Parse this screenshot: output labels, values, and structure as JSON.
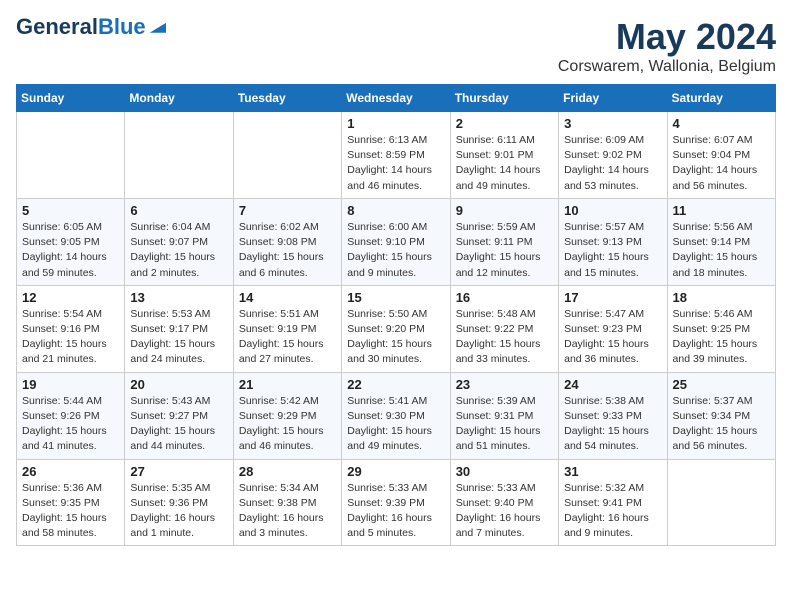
{
  "header": {
    "logo_general": "General",
    "logo_blue": "Blue",
    "title": "May 2024",
    "subtitle": "Corswarem, Wallonia, Belgium"
  },
  "days_of_week": [
    "Sunday",
    "Monday",
    "Tuesday",
    "Wednesday",
    "Thursday",
    "Friday",
    "Saturday"
  ],
  "weeks": [
    [
      {
        "num": "",
        "info": ""
      },
      {
        "num": "",
        "info": ""
      },
      {
        "num": "",
        "info": ""
      },
      {
        "num": "1",
        "info": "Sunrise: 6:13 AM\nSunset: 8:59 PM\nDaylight: 14 hours\nand 46 minutes."
      },
      {
        "num": "2",
        "info": "Sunrise: 6:11 AM\nSunset: 9:01 PM\nDaylight: 14 hours\nand 49 minutes."
      },
      {
        "num": "3",
        "info": "Sunrise: 6:09 AM\nSunset: 9:02 PM\nDaylight: 14 hours\nand 53 minutes."
      },
      {
        "num": "4",
        "info": "Sunrise: 6:07 AM\nSunset: 9:04 PM\nDaylight: 14 hours\nand 56 minutes."
      }
    ],
    [
      {
        "num": "5",
        "info": "Sunrise: 6:05 AM\nSunset: 9:05 PM\nDaylight: 14 hours\nand 59 minutes."
      },
      {
        "num": "6",
        "info": "Sunrise: 6:04 AM\nSunset: 9:07 PM\nDaylight: 15 hours\nand 2 minutes."
      },
      {
        "num": "7",
        "info": "Sunrise: 6:02 AM\nSunset: 9:08 PM\nDaylight: 15 hours\nand 6 minutes."
      },
      {
        "num": "8",
        "info": "Sunrise: 6:00 AM\nSunset: 9:10 PM\nDaylight: 15 hours\nand 9 minutes."
      },
      {
        "num": "9",
        "info": "Sunrise: 5:59 AM\nSunset: 9:11 PM\nDaylight: 15 hours\nand 12 minutes."
      },
      {
        "num": "10",
        "info": "Sunrise: 5:57 AM\nSunset: 9:13 PM\nDaylight: 15 hours\nand 15 minutes."
      },
      {
        "num": "11",
        "info": "Sunrise: 5:56 AM\nSunset: 9:14 PM\nDaylight: 15 hours\nand 18 minutes."
      }
    ],
    [
      {
        "num": "12",
        "info": "Sunrise: 5:54 AM\nSunset: 9:16 PM\nDaylight: 15 hours\nand 21 minutes."
      },
      {
        "num": "13",
        "info": "Sunrise: 5:53 AM\nSunset: 9:17 PM\nDaylight: 15 hours\nand 24 minutes."
      },
      {
        "num": "14",
        "info": "Sunrise: 5:51 AM\nSunset: 9:19 PM\nDaylight: 15 hours\nand 27 minutes."
      },
      {
        "num": "15",
        "info": "Sunrise: 5:50 AM\nSunset: 9:20 PM\nDaylight: 15 hours\nand 30 minutes."
      },
      {
        "num": "16",
        "info": "Sunrise: 5:48 AM\nSunset: 9:22 PM\nDaylight: 15 hours\nand 33 minutes."
      },
      {
        "num": "17",
        "info": "Sunrise: 5:47 AM\nSunset: 9:23 PM\nDaylight: 15 hours\nand 36 minutes."
      },
      {
        "num": "18",
        "info": "Sunrise: 5:46 AM\nSunset: 9:25 PM\nDaylight: 15 hours\nand 39 minutes."
      }
    ],
    [
      {
        "num": "19",
        "info": "Sunrise: 5:44 AM\nSunset: 9:26 PM\nDaylight: 15 hours\nand 41 minutes."
      },
      {
        "num": "20",
        "info": "Sunrise: 5:43 AM\nSunset: 9:27 PM\nDaylight: 15 hours\nand 44 minutes."
      },
      {
        "num": "21",
        "info": "Sunrise: 5:42 AM\nSunset: 9:29 PM\nDaylight: 15 hours\nand 46 minutes."
      },
      {
        "num": "22",
        "info": "Sunrise: 5:41 AM\nSunset: 9:30 PM\nDaylight: 15 hours\nand 49 minutes."
      },
      {
        "num": "23",
        "info": "Sunrise: 5:39 AM\nSunset: 9:31 PM\nDaylight: 15 hours\nand 51 minutes."
      },
      {
        "num": "24",
        "info": "Sunrise: 5:38 AM\nSunset: 9:33 PM\nDaylight: 15 hours\nand 54 minutes."
      },
      {
        "num": "25",
        "info": "Sunrise: 5:37 AM\nSunset: 9:34 PM\nDaylight: 15 hours\nand 56 minutes."
      }
    ],
    [
      {
        "num": "26",
        "info": "Sunrise: 5:36 AM\nSunset: 9:35 PM\nDaylight: 15 hours\nand 58 minutes."
      },
      {
        "num": "27",
        "info": "Sunrise: 5:35 AM\nSunset: 9:36 PM\nDaylight: 16 hours\nand 1 minute."
      },
      {
        "num": "28",
        "info": "Sunrise: 5:34 AM\nSunset: 9:38 PM\nDaylight: 16 hours\nand 3 minutes."
      },
      {
        "num": "29",
        "info": "Sunrise: 5:33 AM\nSunset: 9:39 PM\nDaylight: 16 hours\nand 5 minutes."
      },
      {
        "num": "30",
        "info": "Sunrise: 5:33 AM\nSunset: 9:40 PM\nDaylight: 16 hours\nand 7 minutes."
      },
      {
        "num": "31",
        "info": "Sunrise: 5:32 AM\nSunset: 9:41 PM\nDaylight: 16 hours\nand 9 minutes."
      },
      {
        "num": "",
        "info": ""
      }
    ]
  ]
}
